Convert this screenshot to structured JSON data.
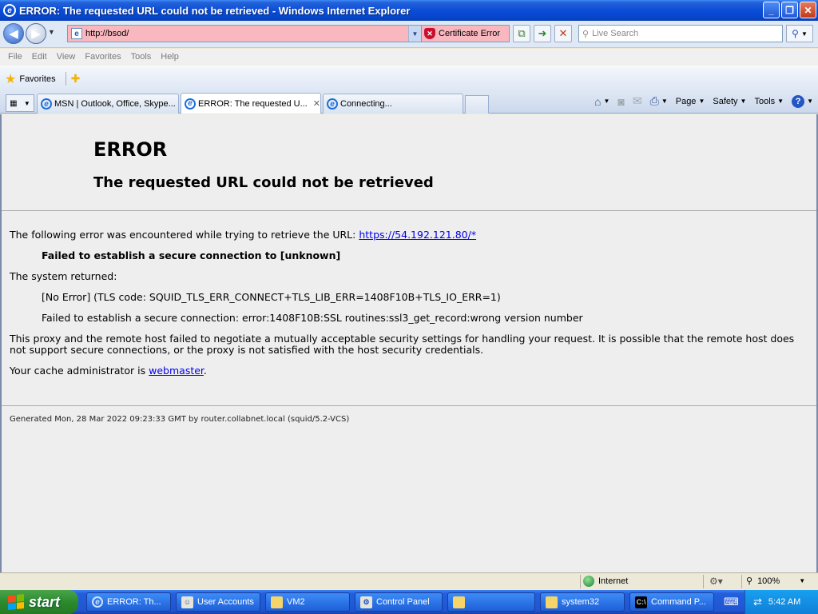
{
  "window": {
    "title": "ERROR: The requested URL could not be retrieved - Windows Internet Explorer"
  },
  "address_bar": {
    "url": "http://bsod/",
    "cert_error": "Certificate Error"
  },
  "search": {
    "placeholder": "Live Search"
  },
  "menu": [
    "File",
    "Edit",
    "View",
    "Favorites",
    "Tools",
    "Help"
  ],
  "favorites": {
    "label": "Favorites"
  },
  "tabs": [
    {
      "label": "MSN | Outlook, Office, Skype..."
    },
    {
      "label": "ERROR: The requested U..."
    },
    {
      "label": "Connecting..."
    }
  ],
  "command_bar": {
    "page": "Page",
    "safety": "Safety",
    "tools": "Tools"
  },
  "page": {
    "heading": "ERROR",
    "subheading": "The requested URL could not be retrieved",
    "intro": "The following error was encountered while trying to retrieve the URL:",
    "url_link": "https://54.192.121.80/*",
    "failed_bold": "Failed to establish a secure connection to [unknown]",
    "system_returned": "The system returned:",
    "tls_code": "[No Error] (TLS code: SQUID_TLS_ERR_CONNECT+TLS_LIB_ERR=1408F10B+TLS_IO_ERR=1)",
    "ssl_detail": "Failed to establish a secure connection: error:1408F10B:SSL routines:ssl3_get_record:wrong version number",
    "explanation": "This proxy and the remote host failed to negotiate a mutually acceptable security settings for handling your request. It is possible that the remote host does not support secure connections, or the proxy is not satisfied with the host security credentials.",
    "admin_prefix": "Your cache administrator is",
    "admin_link": "webmaster",
    "admin_suffix": ".",
    "generated": "Generated Mon, 28 Mar 2022 09:23:33 GMT by router.collabnet.local (squid/5.2-VCS)"
  },
  "status_bar": {
    "zone": "Internet",
    "zoom": "100%"
  },
  "taskbar": {
    "start": "start",
    "items": [
      {
        "label": "ERROR: Th..."
      },
      {
        "label": "User Accounts"
      },
      {
        "label": "VM2"
      },
      {
        "label": "Control Panel"
      },
      {
        "label": ""
      },
      {
        "label": "system32"
      },
      {
        "label": "Command P..."
      }
    ],
    "clock": "5:42 AM"
  }
}
